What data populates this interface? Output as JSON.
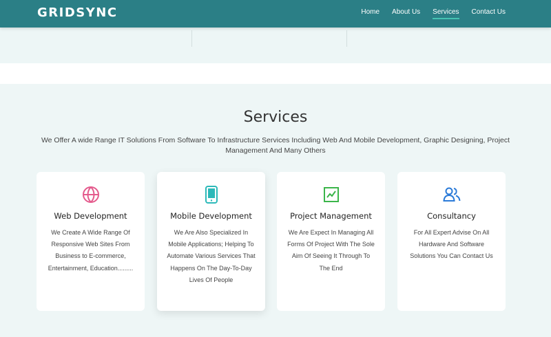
{
  "brand": "GRIDSYNC",
  "nav": {
    "items": [
      {
        "label": "Home"
      },
      {
        "label": "About Us"
      },
      {
        "label": "Services"
      },
      {
        "label": "Contact Us"
      }
    ],
    "active": "Services"
  },
  "services": {
    "title": "Services",
    "description": "We Offer A wide Range IT Solutions From Software To Infrastructure Services Including Web And Mobile Development, Graphic Designing, Project Management And Many Others",
    "cards": [
      {
        "title": "Web Development",
        "text": "We Create A Wide Range Of Responsive Web Sites From Business to E-commerce, Entertainment, Education.........",
        "icon": "globe-icon",
        "icon_color": "#e45a8c"
      },
      {
        "title": "Mobile Development",
        "text": "We Are Also Specialized In Mobile Applications; Helping To Automate Various Services That Happens On The Day-To-Day Lives Of People",
        "icon": "mobile-phone-icon",
        "icon_color": "#2cb9b9"
      },
      {
        "title": "Project Management",
        "text": "We Are Expect In Managing All Forms Of Project With The Sole Aim Of Seeing It Through To The End",
        "icon": "chart-icon",
        "icon_color": "#3bb54a"
      },
      {
        "title": "Consultancy",
        "text": "For All Expert Advise On All Hardware And Software Solutions You Can Contact Us",
        "icon": "users-icon",
        "icon_color": "#2a7ad8"
      }
    ]
  },
  "colors": {
    "navbar": "#2b7f86",
    "nav_active_underline": "#46c3b3",
    "section_background": "#eef6f6"
  }
}
